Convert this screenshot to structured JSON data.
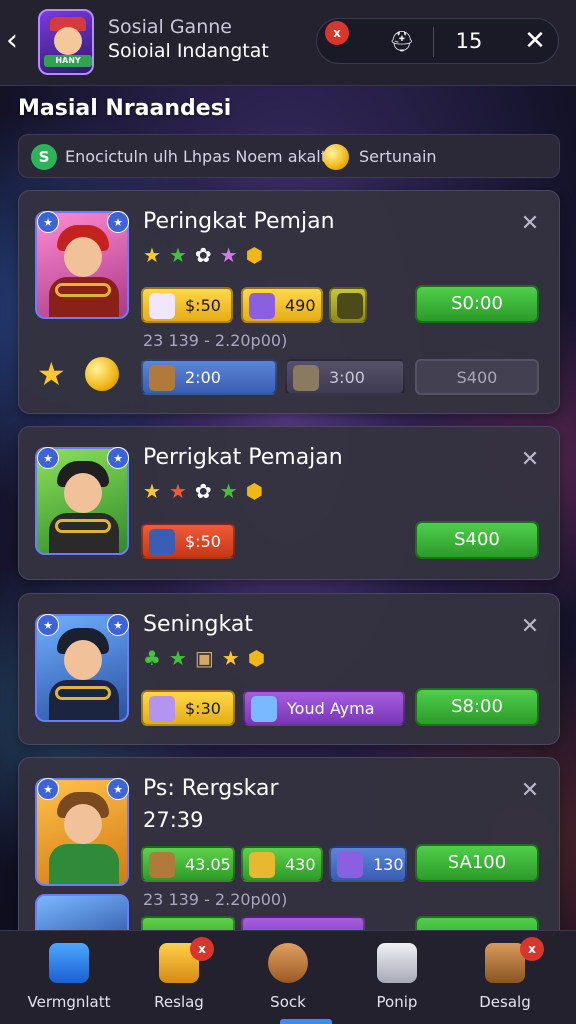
{
  "header": {
    "title": "Sosial Ganne",
    "subtitle": "Soioial Indangtat",
    "logo_text": "HANY",
    "notification_badge": "x",
    "count": "15"
  },
  "section_title": "Masial Nraandesi",
  "info_bar": {
    "text": "Enocictuln ulh Lhpas Noem akalt",
    "action": "Sertunain",
    "icon": "S"
  },
  "cards": [
    {
      "title": "Peringkat Pemjan",
      "chips": [
        "$:50",
        "490"
      ],
      "price": "S0:00",
      "meta": "23   139 - 2.20p00)",
      "row2": [
        "2:00",
        "3:00",
        "S400"
      ]
    },
    {
      "title": "Perrigkat Pemajan",
      "chips": [
        "$:50"
      ],
      "price": "S400"
    },
    {
      "title": "Seningkat",
      "chips": [
        "$:30",
        "Youd Ayma"
      ],
      "price": "S8:00"
    },
    {
      "title": "Ps: Rergskar",
      "level": "27:39",
      "chips": [
        "43.05",
        "430",
        "130"
      ],
      "price": "SA100",
      "meta": "23   139 - 2.20p00)"
    }
  ],
  "nav": [
    {
      "label": "Vermgnlatt",
      "icon": "dice-icon"
    },
    {
      "label": "Reslag",
      "icon": "chest-icon",
      "badge": "x"
    },
    {
      "label": "Sock",
      "icon": "squirrel-icon"
    },
    {
      "label": "Ponip",
      "icon": "robot-icon"
    },
    {
      "label": "Desalg",
      "icon": "crate-icon",
      "badge": "x"
    }
  ],
  "colors": {
    "accent": "#3d8df0",
    "price_green": "#3bb53a",
    "badge_red": "#d8352d"
  }
}
